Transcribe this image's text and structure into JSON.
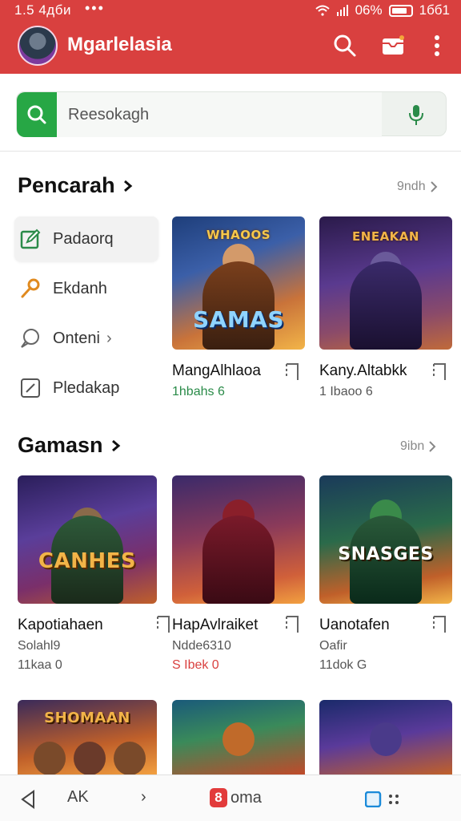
{
  "status_bar": {
    "time": "1.5 4дби",
    "dots": "•••",
    "signal_text": "06%",
    "clock_right": "1бб1"
  },
  "app_bar": {
    "title": "Mgarlelasia"
  },
  "search": {
    "placeholder": "Reesokagh"
  },
  "section1": {
    "title": "Pencarah",
    "more": "9ndh",
    "menu": [
      {
        "label": "Padaorq",
        "icon": "edit-icon",
        "active": true
      },
      {
        "label": "Ekdanh",
        "icon": "key-icon",
        "active": false
      },
      {
        "label": "Onteni",
        "icon": "chat-icon",
        "active": false,
        "chevron": "›"
      },
      {
        "label": "Pledakap",
        "icon": "square-edit-icon",
        "active": false
      }
    ],
    "cards": [
      {
        "art_title": "WHAOOS",
        "art_subtitle": "SAMAS",
        "title": "MangAlhlaoa",
        "meta": "1hbahs 6",
        "meta_style": "green"
      },
      {
        "art_title": "ENEAKAN",
        "title": "Kany.Altabkk",
        "meta": "1 Ibaoo 6",
        "meta_style": "gray"
      }
    ]
  },
  "section2": {
    "title": "Gamasn",
    "more": "9ibn",
    "cards": [
      {
        "art_title": "CANHES",
        "title": "Kapotiahaen",
        "sub": "Solahl9",
        "meta": "11kaa 0",
        "meta_style": "gray"
      },
      {
        "title": "HapAvlraiket",
        "sub": "Ndde6310",
        "meta": "S Ibek 0",
        "meta_style": "red"
      },
      {
        "art_title": "SNASGES",
        "title": "Uanotafen",
        "sub": "Oafir",
        "meta": "11dok G",
        "meta_style": "gray"
      }
    ]
  },
  "section3": {
    "cards": [
      {
        "art_title": "SHOMAAN"
      },
      {},
      {}
    ]
  },
  "bottom_bar": {
    "left_label": "AK",
    "chevron": "›",
    "brand_letter": "8",
    "brand_label": "oma"
  }
}
